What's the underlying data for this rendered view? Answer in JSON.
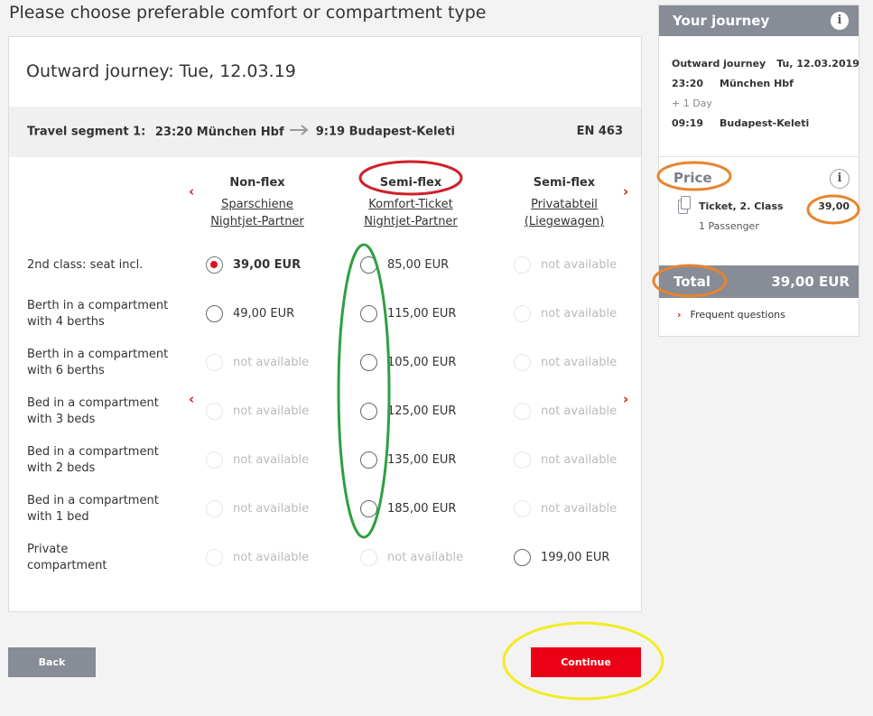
{
  "page": {
    "title": "Please choose preferable comfort or compartment type"
  },
  "journey": {
    "outward_title": "Outward journey: Tue, 12.03.19",
    "segment_label": "Travel segment 1:",
    "segment_departure": "23:20 München Hbf",
    "segment_arrival": "9:19 Budapest-Keleti",
    "train_number": "EN 463"
  },
  "columns": [
    {
      "title": "Non-flex",
      "link_line1": "Sparschiene",
      "link_line2": "Nightjet-Partner"
    },
    {
      "title": "Semi-flex",
      "link_line1": "Komfort-Ticket",
      "link_line2": "Nightjet-Partner"
    },
    {
      "title": "Semi-flex",
      "link_line1": "Privatabteil",
      "link_line2": "(Liegewagen)"
    }
  ],
  "rows": [
    {
      "label_line1": "2nd class: seat incl.",
      "label_line2": "",
      "cells": [
        {
          "text": "39,00 EUR",
          "state": "selected"
        },
        {
          "text": "85,00 EUR",
          "state": "enabled"
        },
        {
          "text": "not available",
          "state": "disabled"
        }
      ]
    },
    {
      "label_line1": "Berth in a compartment",
      "label_line2": "with 4 berths",
      "cells": [
        {
          "text": "49,00 EUR",
          "state": "enabled"
        },
        {
          "text": "115,00 EUR",
          "state": "enabled"
        },
        {
          "text": "not available",
          "state": "disabled"
        }
      ]
    },
    {
      "label_line1": "Berth in a compartment",
      "label_line2": "with 6 berths",
      "cells": [
        {
          "text": "not available",
          "state": "disabled"
        },
        {
          "text": "105,00 EUR",
          "state": "enabled"
        },
        {
          "text": "not available",
          "state": "disabled"
        }
      ]
    },
    {
      "label_line1": "Bed in a compartment",
      "label_line2": "with 3 beds",
      "cells": [
        {
          "text": "not available",
          "state": "disabled"
        },
        {
          "text": "125,00 EUR",
          "state": "enabled"
        },
        {
          "text": "not available",
          "state": "disabled"
        }
      ]
    },
    {
      "label_line1": "Bed in a compartment",
      "label_line2": "with 2 beds",
      "cells": [
        {
          "text": "not available",
          "state": "disabled"
        },
        {
          "text": "135,00 EUR",
          "state": "enabled"
        },
        {
          "text": "not available",
          "state": "disabled"
        }
      ]
    },
    {
      "label_line1": "Bed in a compartment",
      "label_line2": "with 1 bed",
      "cells": [
        {
          "text": "not available",
          "state": "disabled"
        },
        {
          "text": "185,00 EUR",
          "state": "enabled"
        },
        {
          "text": "not available",
          "state": "disabled"
        }
      ]
    },
    {
      "label_line1": "Private",
      "label_line2": "compartment",
      "cells": [
        {
          "text": "not available",
          "state": "disabled"
        },
        {
          "text": "not available",
          "state": "disabled"
        },
        {
          "text": "199,00 EUR",
          "state": "enabled"
        }
      ]
    }
  ],
  "sidebar": {
    "title": "Your journey",
    "outward_label": "Outward journey",
    "outward_date": "Tu, 12.03.2019",
    "dep_time": "23:20",
    "dep_station": "München Hbf",
    "day_offset": "+ 1 Day",
    "arr_time": "09:19",
    "arr_station": "Budapest-Keleti",
    "price_title": "Price",
    "ticket_label": "Ticket, 2. Class",
    "ticket_price": "39,00",
    "passengers": "1 Passenger",
    "total_label": "Total",
    "total_value": "39,00 EUR",
    "faq_label": "Frequent questions"
  },
  "buttons": {
    "back": "Back",
    "continue": "Continue"
  },
  "icons": {
    "info": "info-icon",
    "ticket": "ticket-icon",
    "arrow": "arrow-right-icon",
    "chevron_left": "chevron-left-icon",
    "chevron_right": "chevron-right-icon"
  },
  "colors": {
    "accent_red": "#ec0016",
    "header_grey": "#878c96",
    "segment_bg": "#f0f0f0",
    "annotation_red": "#d0202a",
    "annotation_green": "#2fa043",
    "annotation_orange": "#e8842c",
    "annotation_yellow": "#f2ec21"
  }
}
